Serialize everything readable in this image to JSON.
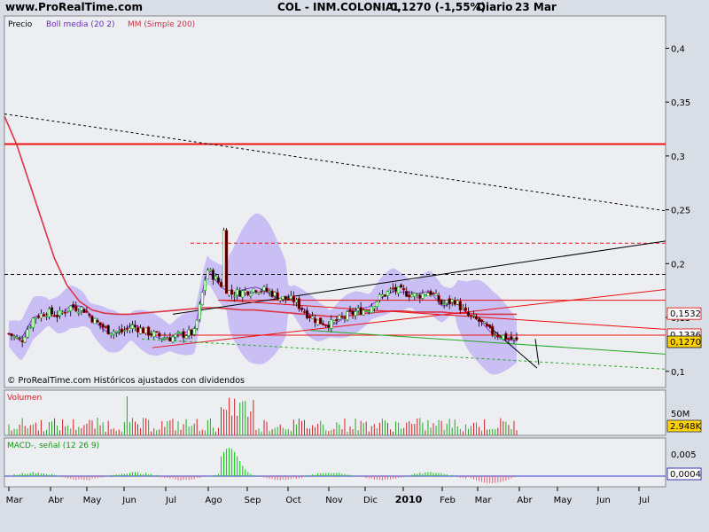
{
  "header": {
    "site": "www.ProRealTime.com",
    "ticker": "COL - INM.COLONIAL",
    "price": "0,1270 (-1,55%)",
    "period": "Diario",
    "date": "23 Mar"
  },
  "colors": {
    "background": "#d8dde6",
    "panel_bg": "#eceef2",
    "boll_band": "#c4b6f5",
    "mm200": "#dd3344",
    "horizontal_red": "#ee1111",
    "up_candle": "#00aa00",
    "down_candle": "#cc0000",
    "macd_line": "#00cc00",
    "signal_line": "#3333cc"
  },
  "chart_data": [
    {
      "type": "candlestick",
      "panel": "price",
      "legend": [
        "Precio",
        "Boll media (20 2)",
        "MM (Simple 200)"
      ],
      "footer_note": "© ProRealTime.com Históricos ajustados con dividendos",
      "ylim": [
        0.085,
        0.43
      ],
      "y_ticks": [
        {
          "value": 0.4,
          "label": "0,4"
        },
        {
          "value": 0.35,
          "label": "0,35"
        },
        {
          "value": 0.3,
          "label": "0,3"
        },
        {
          "value": 0.25,
          "label": "0,25"
        },
        {
          "value": 0.2,
          "label": "0,2"
        },
        {
          "value": 0.15,
          "label": "0,15"
        },
        {
          "value": 0.1,
          "label": "0,1"
        }
      ],
      "price_tags": [
        {
          "value": 0.1532,
          "label": "0,1532",
          "style": "plain"
        },
        {
          "value": 0.1336,
          "label": "0,1336",
          "style": "plain"
        },
        {
          "value": 0.127,
          "label": "0,1270",
          "style": "highlight"
        }
      ],
      "series": [
        {
          "name": "Precio",
          "values": [
            0.135,
            0.128,
            0.15,
            0.155,
            0.152,
            0.16,
            0.158,
            0.146,
            0.138,
            0.136,
            0.142,
            0.137,
            0.133,
            0.131,
            0.134,
            0.136,
            0.195,
            0.182,
            0.172,
            0.174,
            0.177,
            0.174,
            0.168,
            0.166,
            0.154,
            0.146,
            0.144,
            0.15,
            0.155,
            0.158,
            0.169,
            0.176,
            0.173,
            0.17,
            0.174,
            0.162,
            0.166,
            0.152,
            0.146,
            0.136,
            0.132,
            0.128
          ]
        },
        {
          "name": "MM (Simple 200)",
          "values": [
            0.337,
            0.31,
            0.275,
            0.24,
            0.205,
            0.18,
            0.165,
            0.157,
            0.154,
            0.153,
            0.153,
            0.154,
            0.155,
            0.156,
            0.157,
            0.158,
            0.159,
            0.159,
            0.158,
            0.157,
            0.157,
            0.156,
            0.155,
            0.154,
            0.153,
            0.152,
            0.151,
            0.151,
            0.152,
            0.154,
            0.155,
            0.156,
            0.156,
            0.155,
            0.155,
            0.155,
            0.154,
            0.154,
            0.153,
            0.153,
            0.153,
            0.153
          ]
        }
      ],
      "horizontal_lines": [
        {
          "value": 0.311,
          "style": "solid",
          "color": "red"
        },
        {
          "value": 0.219,
          "style": "dashed",
          "color": "red"
        },
        {
          "value": 0.19,
          "style": "dashed",
          "color": "black"
        },
        {
          "value": 0.166,
          "style": "solid",
          "color": "red"
        },
        {
          "value": 0.1336,
          "style": "solid",
          "color": "red"
        }
      ]
    },
    {
      "type": "bar",
      "panel": "volume",
      "legend": "Volumen",
      "y_ticks": [
        {
          "value": 50000000,
          "label": "50M"
        }
      ],
      "last_value_label": "2.948K"
    },
    {
      "type": "line",
      "panel": "macd",
      "legend": "MACD-, señal (12 26 9)",
      "ylim": [
        -0.004,
        0.008
      ],
      "y_ticks": [
        {
          "value": 0.005,
          "label": "0,005"
        },
        {
          "value": 0.0004,
          "label": "0,0004"
        }
      ],
      "last_value_label": "0,0004"
    },
    {
      "type": "time_axis",
      "months": [
        {
          "label": "Mar",
          "bold": false
        },
        {
          "label": "Abr",
          "bold": false
        },
        {
          "label": "May",
          "bold": false
        },
        {
          "label": "Jun",
          "bold": false
        },
        {
          "label": "Jul",
          "bold": false
        },
        {
          "label": "Ago",
          "bold": false
        },
        {
          "label": "Sep",
          "bold": false
        },
        {
          "label": "Oct",
          "bold": false
        },
        {
          "label": "Nov",
          "bold": false
        },
        {
          "label": "Dic",
          "bold": false
        },
        {
          "label": "2010",
          "bold": true
        },
        {
          "label": "Feb",
          "bold": false
        },
        {
          "label": "Mar",
          "bold": false
        },
        {
          "label": "Abr",
          "bold": false
        },
        {
          "label": "May",
          "bold": false
        },
        {
          "label": "Jun",
          "bold": false
        },
        {
          "label": "Jul",
          "bold": false
        }
      ]
    }
  ]
}
